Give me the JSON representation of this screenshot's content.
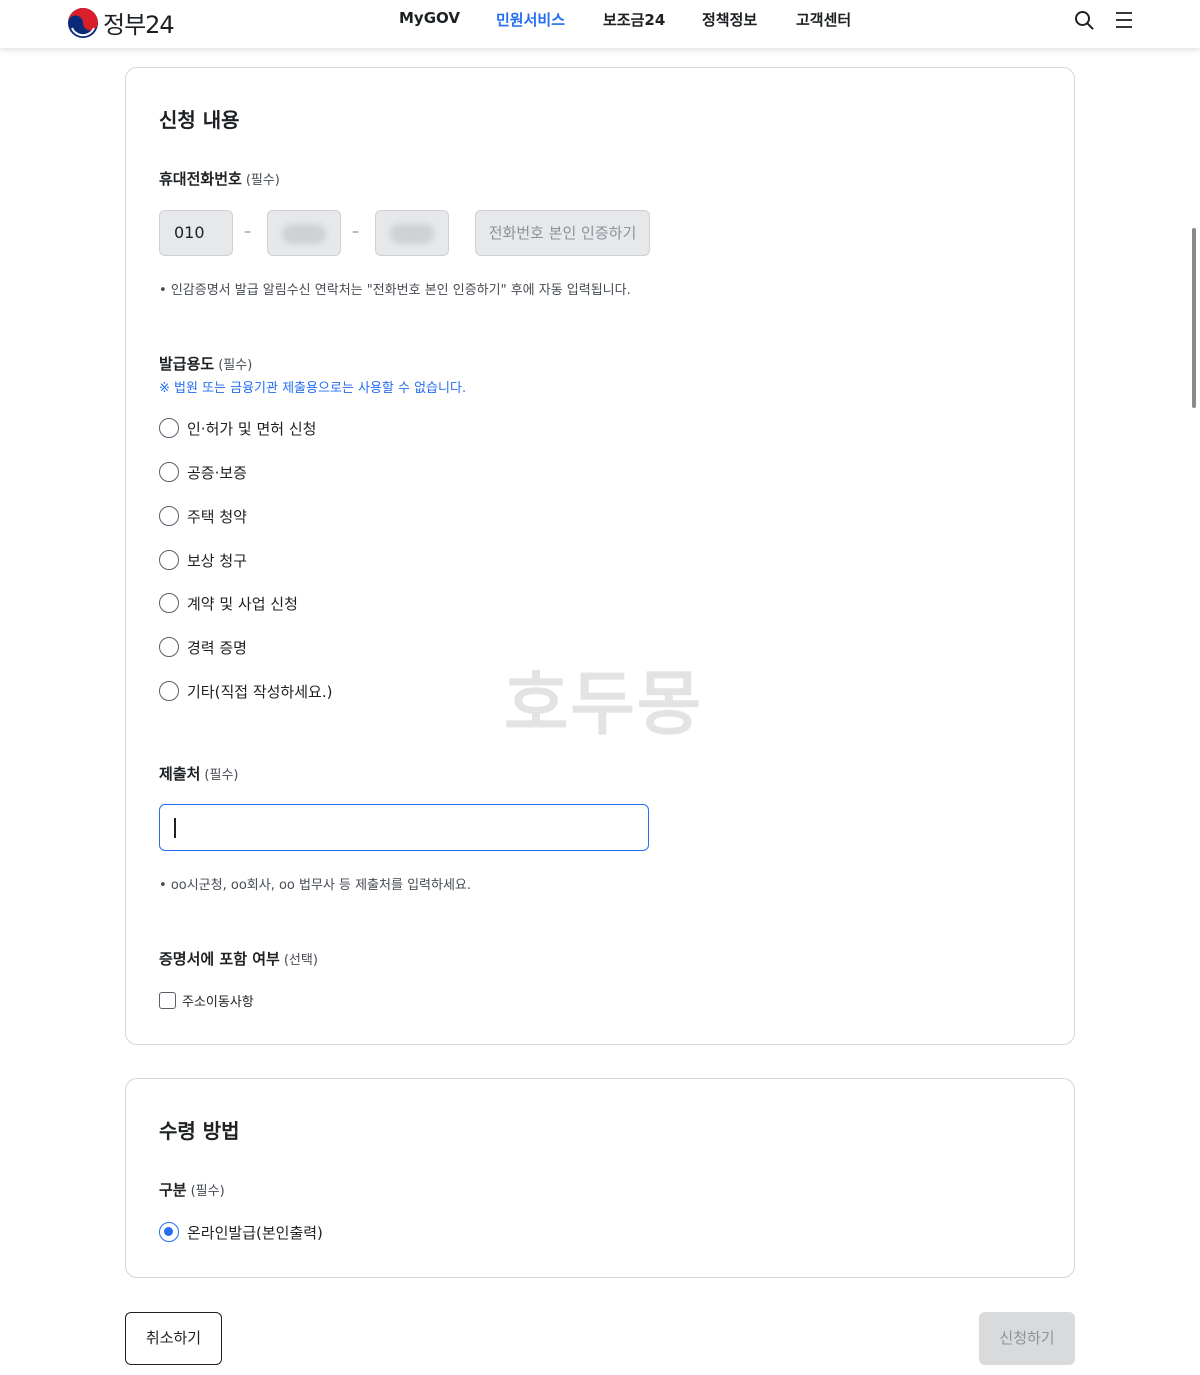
{
  "header": {
    "logo_text": "정부24",
    "nav": [
      "MyGOV",
      "민원서비스",
      "보조금24",
      "정책정보",
      "고객센터"
    ],
    "active_nav": "민원서비스",
    "icons": [
      "search-icon",
      "menu-icon"
    ]
  },
  "apply": {
    "title": "신청 내용",
    "phone": {
      "label": "휴대전화번호",
      "required": "(필수)",
      "prefix": "010",
      "separator": "–",
      "verify_button": "전화번호 본인 인증하기",
      "note": "인감증명서 발급 알림수신 연락처는 \"전화번호 본인 인증하기\" 후에 자동 입력됩니다."
    },
    "purpose": {
      "label": "발급용도",
      "required": "(필수)",
      "warning": "※ 법원 또는 금융기관 제출용으로는 사용할 수 없습니다.",
      "options": [
        "인·허가 및 면허 신청",
        "공증·보증",
        "주택 청약",
        "보상 청구",
        "계약 및 사업 신청",
        "경력 증명",
        "기타(직접 작성하세요.)"
      ]
    },
    "submit_to": {
      "label": "제출처",
      "required": "(필수)",
      "value": "",
      "note": "oo시군청, oo회사, oo 법무사 등 제출처를 입력하세요."
    },
    "include": {
      "label": "증명서에 포함 여부",
      "optional": "(선택)",
      "checkbox_label": "주소이동사항",
      "checked": false
    }
  },
  "receive": {
    "title": "수령 방법",
    "label": "구분",
    "required": "(필수)",
    "option": "온라인발급(본인출력)",
    "selected": true
  },
  "watermark": "호두몽",
  "actions": {
    "cancel": "취소하기",
    "submit": "신청하기"
  },
  "colors": {
    "accent": "#256ef4",
    "text": "#1e2124",
    "disabled_bg": "#d9dadb"
  }
}
